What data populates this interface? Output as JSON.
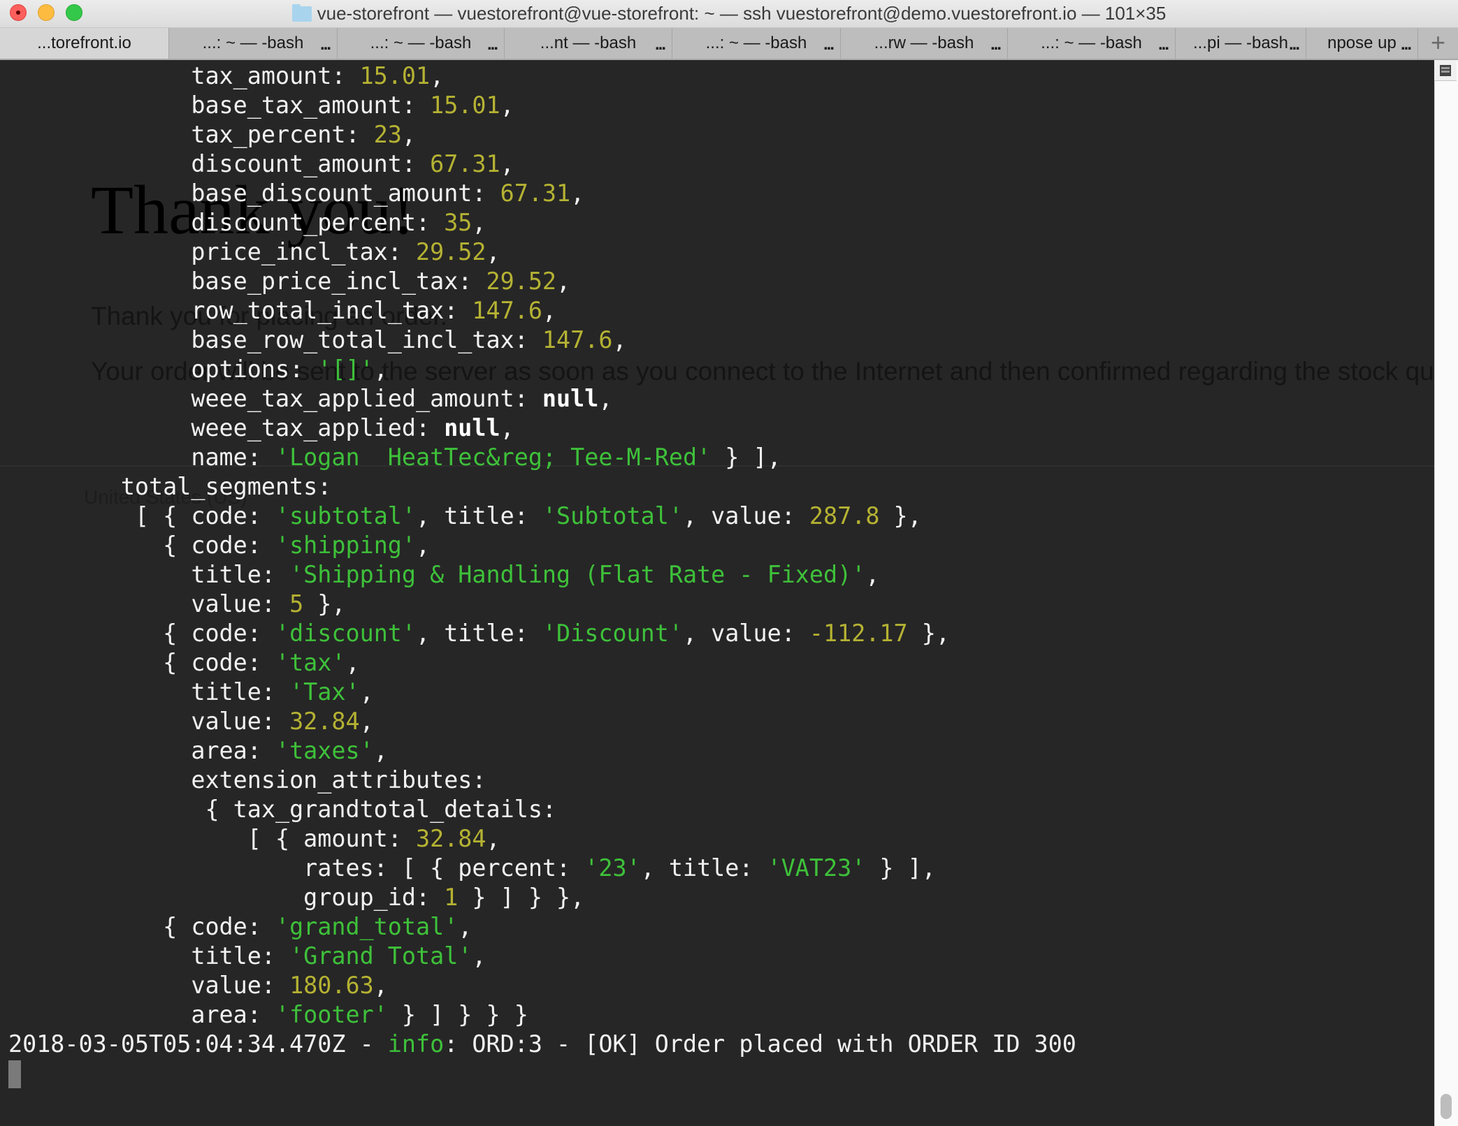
{
  "window": {
    "title": "vue-storefront — vuestorefront@vue-storefront: ~ — ssh vuestorefront@demo.vuestorefront.io — 101×35",
    "folder_icon": "folder-icon"
  },
  "tabs": [
    {
      "label": "...torefront.io",
      "active": true
    },
    {
      "label": "...: ~ — -bash",
      "active": false
    },
    {
      "label": "...: ~ — -bash",
      "active": false
    },
    {
      "label": "...nt — -bash",
      "active": false
    },
    {
      "label": "...: ~ — -bash",
      "active": false
    },
    {
      "label": "...rw — -bash",
      "active": false
    },
    {
      "label": "...: ~ — -bash",
      "active": false
    },
    {
      "label": "...pi — -bash",
      "active": false
    },
    {
      "label": "npose up",
      "active": false
    }
  ],
  "tab_more_label": "...",
  "new_tab_label": "+",
  "background_page": {
    "heading": "Thank you!",
    "para1": "Thank you for placing an order.",
    "para2": "Your order will be sent to the server as soon as you connect to the Internet and then confirmed regarding the stock quantities",
    "country": "United States (US)"
  },
  "terminal_lines": [
    [
      [
        13,
        ""
      ],
      [
        "k",
        "tax_amount: "
      ],
      [
        "n",
        "15.01"
      ],
      [
        "k",
        ","
      ]
    ],
    [
      [
        13,
        ""
      ],
      [
        "k",
        "base_tax_amount: "
      ],
      [
        "n",
        "15.01"
      ],
      [
        "k",
        ","
      ]
    ],
    [
      [
        13,
        ""
      ],
      [
        "k",
        "tax_percent: "
      ],
      [
        "n",
        "23"
      ],
      [
        "k",
        ","
      ]
    ],
    [
      [
        13,
        ""
      ],
      [
        "k",
        "discount_amount: "
      ],
      [
        "n",
        "67.31"
      ],
      [
        "k",
        ","
      ]
    ],
    [
      [
        13,
        ""
      ],
      [
        "k",
        "base_discount_amount: "
      ],
      [
        "n",
        "67.31"
      ],
      [
        "k",
        ","
      ]
    ],
    [
      [
        13,
        ""
      ],
      [
        "k",
        "discount_percent: "
      ],
      [
        "n",
        "35"
      ],
      [
        "k",
        ","
      ]
    ],
    [
      [
        13,
        ""
      ],
      [
        "k",
        "price_incl_tax: "
      ],
      [
        "n",
        "29.52"
      ],
      [
        "k",
        ","
      ]
    ],
    [
      [
        13,
        ""
      ],
      [
        "k",
        "base_price_incl_tax: "
      ],
      [
        "n",
        "29.52"
      ],
      [
        "k",
        ","
      ]
    ],
    [
      [
        13,
        ""
      ],
      [
        "k",
        "row_total_incl_tax: "
      ],
      [
        "n",
        "147.6"
      ],
      [
        "k",
        ","
      ]
    ],
    [
      [
        13,
        ""
      ],
      [
        "k",
        "base_row_total_incl_tax: "
      ],
      [
        "n",
        "147.6"
      ],
      [
        "k",
        ","
      ]
    ],
    [
      [
        13,
        ""
      ],
      [
        "k",
        "options: "
      ],
      [
        "s",
        "'[]'"
      ],
      [
        "k",
        ","
      ]
    ],
    [
      [
        13,
        ""
      ],
      [
        "k",
        "weee_tax_applied_amount: "
      ],
      [
        "b",
        "null"
      ],
      [
        "k",
        ","
      ]
    ],
    [
      [
        13,
        ""
      ],
      [
        "k",
        "weee_tax_applied: "
      ],
      [
        "b",
        "null"
      ],
      [
        "k",
        ","
      ]
    ],
    [
      [
        13,
        ""
      ],
      [
        "k",
        "name: "
      ],
      [
        "s",
        "'Logan  HeatTec&reg; Tee-M-Red'"
      ],
      [
        "k",
        " } ],"
      ]
    ],
    [
      [
        8,
        ""
      ],
      [
        "k",
        "total_segments:"
      ]
    ],
    [
      [
        9,
        ""
      ],
      [
        "k",
        "[ { code: "
      ],
      [
        "s",
        "'subtotal'"
      ],
      [
        "k",
        ", title: "
      ],
      [
        "s",
        "'Subtotal'"
      ],
      [
        "k",
        ", value: "
      ],
      [
        "n",
        "287.8"
      ],
      [
        "k",
        " },"
      ]
    ],
    [
      [
        11,
        ""
      ],
      [
        "k",
        "{ code: "
      ],
      [
        "s",
        "'shipping'"
      ],
      [
        "k",
        ","
      ]
    ],
    [
      [
        13,
        ""
      ],
      [
        "k",
        "title: "
      ],
      [
        "s",
        "'Shipping & Handling (Flat Rate - Fixed)'"
      ],
      [
        "k",
        ","
      ]
    ],
    [
      [
        13,
        ""
      ],
      [
        "k",
        "value: "
      ],
      [
        "n",
        "5"
      ],
      [
        "k",
        " },"
      ]
    ],
    [
      [
        11,
        ""
      ],
      [
        "k",
        "{ code: "
      ],
      [
        "s",
        "'discount'"
      ],
      [
        "k",
        ", title: "
      ],
      [
        "s",
        "'Discount'"
      ],
      [
        "k",
        ", value: "
      ],
      [
        "n",
        "-112.17"
      ],
      [
        "k",
        " },"
      ]
    ],
    [
      [
        11,
        ""
      ],
      [
        "k",
        "{ code: "
      ],
      [
        "s",
        "'tax'"
      ],
      [
        "k",
        ","
      ]
    ],
    [
      [
        13,
        ""
      ],
      [
        "k",
        "title: "
      ],
      [
        "s",
        "'Tax'"
      ],
      [
        "k",
        ","
      ]
    ],
    [
      [
        13,
        ""
      ],
      [
        "k",
        "value: "
      ],
      [
        "n",
        "32.84"
      ],
      [
        "k",
        ","
      ]
    ],
    [
      [
        13,
        ""
      ],
      [
        "k",
        "area: "
      ],
      [
        "s",
        "'taxes'"
      ],
      [
        "k",
        ","
      ]
    ],
    [
      [
        13,
        ""
      ],
      [
        "k",
        "extension_attributes:"
      ]
    ],
    [
      [
        14,
        ""
      ],
      [
        "k",
        "{ tax_grandtotal_details:"
      ]
    ],
    [
      [
        17,
        ""
      ],
      [
        "k",
        "[ { amount: "
      ],
      [
        "n",
        "32.84"
      ],
      [
        "k",
        ","
      ]
    ],
    [
      [
        21,
        ""
      ],
      [
        "k",
        "rates: [ { percent: "
      ],
      [
        "s",
        "'23'"
      ],
      [
        "k",
        ", title: "
      ],
      [
        "s",
        "'VAT23'"
      ],
      [
        "k",
        " } ],"
      ]
    ],
    [
      [
        21,
        ""
      ],
      [
        "k",
        "group_id: "
      ],
      [
        "n",
        "1"
      ],
      [
        "k",
        " } ] } },"
      ]
    ],
    [
      [
        11,
        ""
      ],
      [
        "k",
        "{ code: "
      ],
      [
        "s",
        "'grand_total'"
      ],
      [
        "k",
        ","
      ]
    ],
    [
      [
        13,
        ""
      ],
      [
        "k",
        "title: "
      ],
      [
        "s",
        "'Grand Total'"
      ],
      [
        "k",
        ","
      ]
    ],
    [
      [
        13,
        ""
      ],
      [
        "k",
        "value: "
      ],
      [
        "n",
        "180.63"
      ],
      [
        "k",
        ","
      ]
    ],
    [
      [
        13,
        ""
      ],
      [
        "k",
        "area: "
      ],
      [
        "s",
        "'footer'"
      ],
      [
        "k",
        " } ] } } }"
      ]
    ],
    [
      [
        0,
        ""
      ],
      [
        "k",
        "2018-03-05T05:04:34.470Z - "
      ],
      [
        "s",
        "info"
      ],
      [
        "k",
        ": ORD:3 - [OK] Order placed with ORDER ID 300"
      ]
    ]
  ],
  "colors": {
    "terminal_bg": "#262626",
    "text": "#f2f2f2",
    "number": "#b5b233",
    "string": "#3ec13a"
  }
}
